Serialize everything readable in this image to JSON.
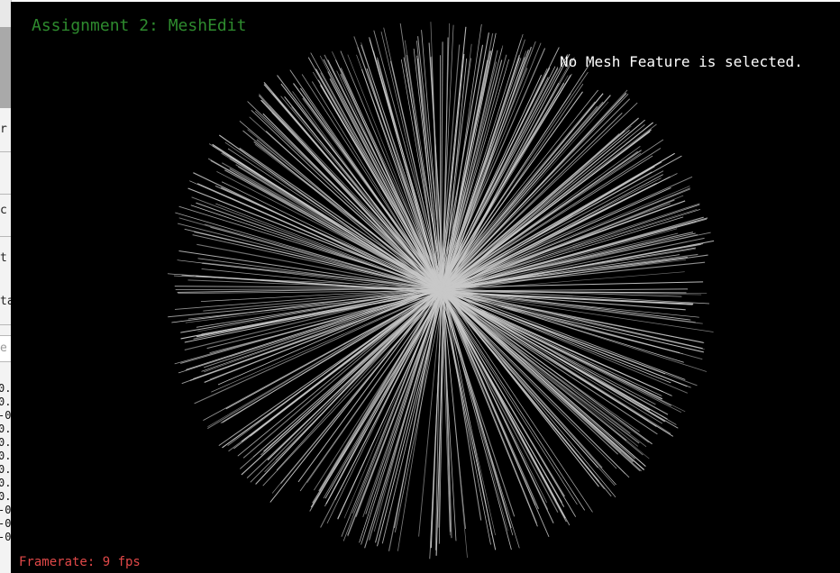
{
  "viewer": {
    "title": "Assignment 2: MeshEdit",
    "selection_status": "No Mesh Feature is selected.",
    "framerate": "Framerate: 9 fps",
    "background_color": "#000000",
    "title_color": "#2e8b2e",
    "framerate_color": "#e04848",
    "mesh_line_color": "#c8c8c8"
  },
  "background_window": {
    "fragments": [
      "r",
      "c",
      "t",
      "ta",
      "e"
    ],
    "numbers": [
      "0.",
      "0.",
      "-0",
      "0.",
      "0.",
      "0.",
      "0.",
      "0.",
      "0.",
      "-0",
      "-0",
      "-0"
    ]
  }
}
